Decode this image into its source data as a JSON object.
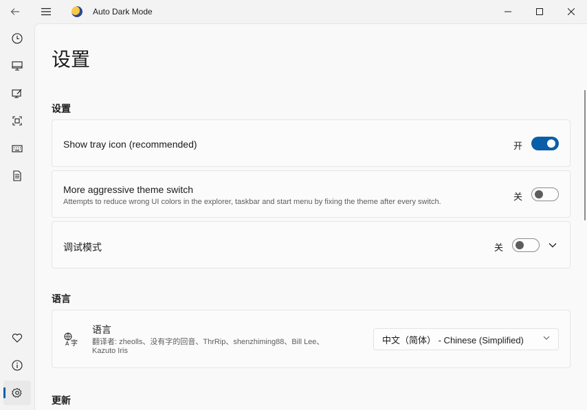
{
  "window": {
    "title": "Auto Dark Mode"
  },
  "nav": {
    "items": [
      {
        "name": "time-icon"
      },
      {
        "name": "monitor-icon"
      },
      {
        "name": "personalize-icon"
      },
      {
        "name": "scripts-icon"
      },
      {
        "name": "hotkeys-icon"
      },
      {
        "name": "log-icon"
      }
    ],
    "bottom": [
      {
        "name": "donate-icon"
      },
      {
        "name": "about-icon"
      },
      {
        "name": "settings-icon",
        "active": true
      }
    ]
  },
  "page": {
    "title": "设置"
  },
  "sections": {
    "settings": {
      "title": "设置",
      "tray": {
        "label": "Show tray icon (recommended)",
        "state": "开",
        "on": true
      },
      "aggressive": {
        "label": "More aggressive theme switch",
        "desc": "Attempts to reduce wrong UI colors in the explorer, taskbar and start menu by fixing the theme after every switch.",
        "state": "关",
        "on": false
      },
      "debug": {
        "label": "调试模式",
        "state": "关",
        "on": false
      }
    },
    "language": {
      "title": "语言",
      "card": {
        "label": "语言",
        "translators_line1": "翻译者: zheolls、没有字的回音、ThrRip、shenzhiming88、Bill Lee、",
        "translators_line2": "Kazuto Iris",
        "selected": "中文（简体） - Chinese (Simplified)"
      }
    },
    "update": {
      "title": "更新"
    }
  },
  "colors": {
    "accent": "#0a5ea8"
  }
}
